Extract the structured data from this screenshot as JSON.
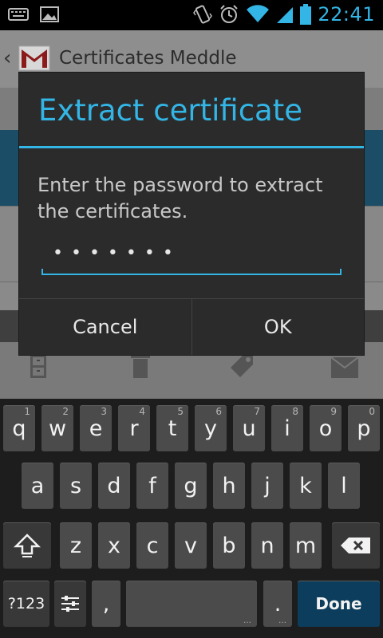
{
  "status_bar": {
    "time": "22:41",
    "icons_left": [
      "keyboard-icon",
      "image-icon"
    ],
    "icons_right": [
      "vibrate-icon",
      "alarm-icon",
      "wifi-icon",
      "signal-icon",
      "battery-icon"
    ],
    "accent": "#33b5e5"
  },
  "app": {
    "title": "Certificates Meddle",
    "back_glyph": "‹",
    "close_glyph": "×"
  },
  "dialog": {
    "title": "Extract certificate",
    "message": "Enter the password to extract the certificates.",
    "password_mask": "•••••••",
    "cancel_label": "Cancel",
    "ok_label": "OK"
  },
  "keyboard": {
    "row1": [
      {
        "label": "q",
        "num": "1"
      },
      {
        "label": "w",
        "num": "2"
      },
      {
        "label": "e",
        "num": "3"
      },
      {
        "label": "r",
        "num": "4"
      },
      {
        "label": "t",
        "num": "5"
      },
      {
        "label": "y",
        "num": "6"
      },
      {
        "label": "u",
        "num": "7"
      },
      {
        "label": "i",
        "num": "8"
      },
      {
        "label": "o",
        "num": "9"
      },
      {
        "label": "p",
        "num": "0"
      }
    ],
    "row2": [
      "a",
      "s",
      "d",
      "f",
      "g",
      "h",
      "j",
      "k",
      "l"
    ],
    "row3": [
      "z",
      "x",
      "c",
      "v",
      "b",
      "n",
      "m"
    ],
    "sym_label": "?123",
    "comma": ",",
    "period": ".",
    "done_label": "Done"
  }
}
